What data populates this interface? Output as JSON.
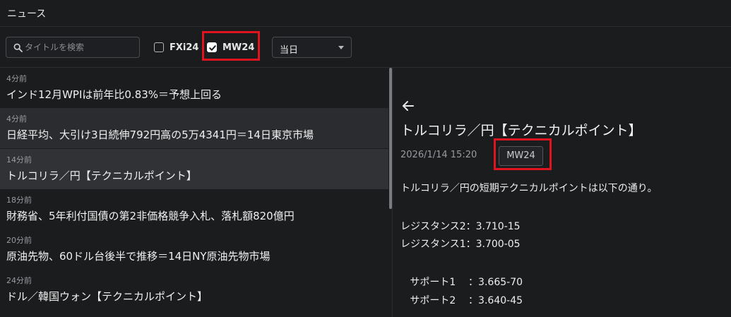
{
  "window": {
    "title": "ニュース"
  },
  "toolbar": {
    "search_placeholder": "タイトルを検索",
    "filters": [
      {
        "label": "FXi24",
        "checked": false
      },
      {
        "label": "MW24",
        "checked": true
      }
    ],
    "date_select": {
      "value": "当日"
    }
  },
  "news_list": [
    {
      "time": "4分前",
      "headline": "インド12月WPIは前年比0.83%＝予想上回る"
    },
    {
      "time": "4分前",
      "headline": "日経平均、大引け3日続伸792円高の5万4341円＝14日東京市場"
    },
    {
      "time": "14分前",
      "headline": "トルコリラ／円【テクニカルポイント】"
    },
    {
      "time": "18分前",
      "headline": "財務省、5年利付国債の第2非価格競争入札、落札額820億円"
    },
    {
      "time": "20分前",
      "headline": "原油先物、60ドル台後半で推移＝14日NY原油先物市場"
    },
    {
      "time": "24分前",
      "headline": "ドル／韓国ウォン【テクニカルポイント】"
    }
  ],
  "detail": {
    "title": "トルコリラ／円【テクニカルポイント】",
    "datetime": "2026/1/14 15:20",
    "source_tag": "MW24",
    "lines": [
      "トルコリラ／円の短期テクニカルポイントは以下の通り。",
      "レジスタンス2：3.710-15",
      "レジスタンス1：3.700-05",
      "   サポート1    ：3.665-70",
      "   サポート2    ：3.640-45"
    ]
  },
  "colors": {
    "background": "#1b1c1e",
    "selected_row": "#303236",
    "highlight_border": "#e0141e"
  }
}
